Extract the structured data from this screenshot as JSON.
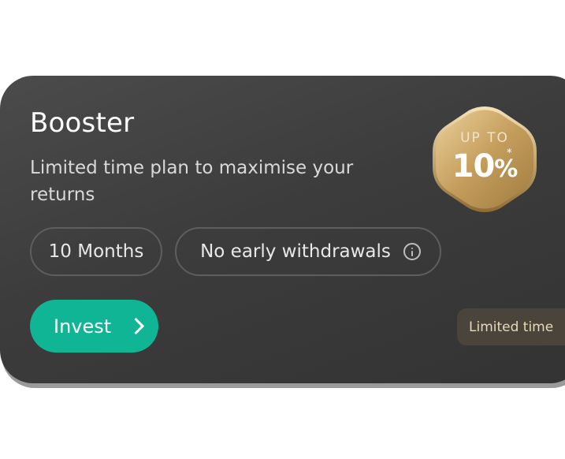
{
  "card": {
    "title": "Booster",
    "subtitle": "Limited time plan to maximise your returns"
  },
  "badge": {
    "top_label": "UP TO",
    "value": "10",
    "unit": "%",
    "footnote_mark": "*",
    "colors": {
      "gold_light": "#e6c486",
      "gold_dark": "#a98445"
    }
  },
  "chips": [
    {
      "label": "10 Months"
    },
    {
      "label": "No early withdrawals",
      "icon": "info-icon"
    }
  ],
  "actions": {
    "invest_label": "Invest",
    "invest_icon": "chevron-right-icon",
    "accent_color": "#10b595"
  },
  "tag": {
    "label": "Limited time"
  }
}
